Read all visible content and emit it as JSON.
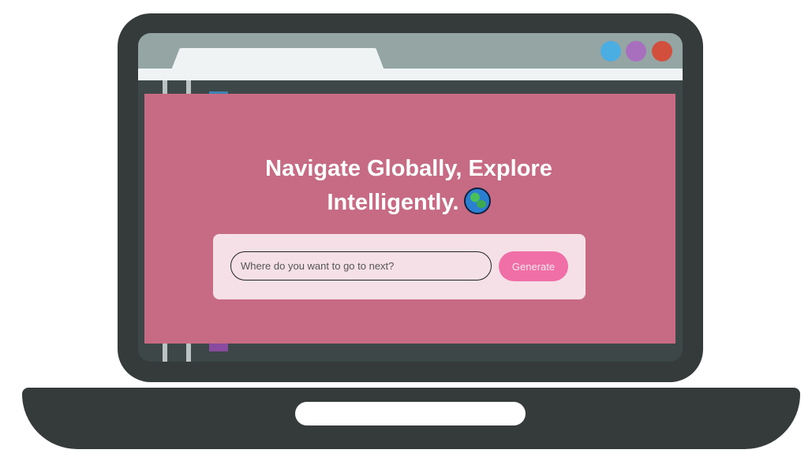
{
  "hero": {
    "headline": "Navigate Globally, Explore Intelligently.",
    "emoji_icon": "globe-icon"
  },
  "search": {
    "placeholder": "Where do you want to go to next?",
    "value": ""
  },
  "actions": {
    "generate_label": "Generate"
  },
  "colors": {
    "page_background": "#c66b83",
    "card_background": "#f4e0e6",
    "button_background": "#ef6fa6",
    "window_dot_blue": "#4aaee3",
    "window_dot_purple": "#a76fbe",
    "window_dot_red": "#d24f3e"
  }
}
